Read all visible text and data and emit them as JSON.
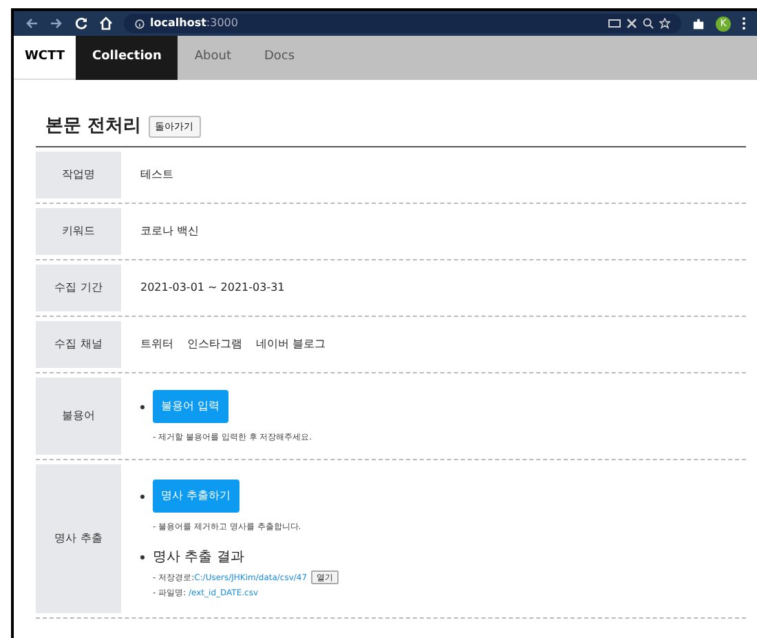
{
  "browser": {
    "url_host": "localhost",
    "url_port": ":3000",
    "avatar": "K"
  },
  "nav": {
    "brand": "WCTT",
    "items": [
      {
        "label": "Collection",
        "selected": true
      },
      {
        "label": "About",
        "selected": false
      },
      {
        "label": "Docs",
        "selected": false
      }
    ]
  },
  "page": {
    "title": "본문 전처리",
    "back_button": "돌아가기"
  },
  "rows": [
    {
      "kind": "text",
      "label": "작업명",
      "value": "테스트"
    },
    {
      "kind": "text",
      "label": "키워드",
      "value": "코로나 백신"
    },
    {
      "kind": "text",
      "label": "수집 기간",
      "value": "2021-03-01 ~ 2021-03-31"
    },
    {
      "kind": "channels",
      "label": "수집 채널",
      "channels": [
        "트위터",
        "인스타그램",
        "네이버 블로그"
      ]
    },
    {
      "kind": "action",
      "label": "불용어",
      "button": "불용어 입력",
      "note": "- 제거할 불용어를 입력한 후 저장해주세요."
    },
    {
      "kind": "extract",
      "label": "명사 추출",
      "button": "명사 추출하기",
      "note": "- 불용어를 제거하고 명사를 추출합니다.",
      "result_title": "명사 추출 결과",
      "path_label": "- 저장경로:",
      "path": "C:/Users/JHKim/data/csv/47",
      "open_button": "열기",
      "file_label": "- 파일명: ",
      "file": "/ext_id_DATE.csv"
    }
  ]
}
